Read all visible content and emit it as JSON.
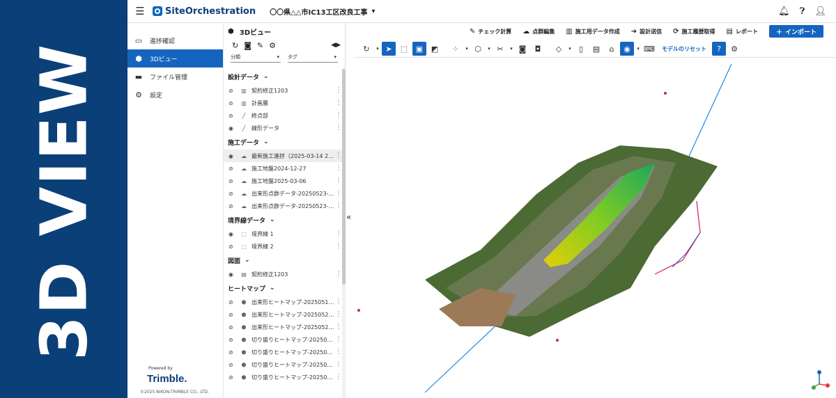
{
  "banner": {
    "text": "3D VIEW"
  },
  "app": {
    "name": "SiteOrchestration",
    "project": "〇〇県△△市IC13工区改良工事"
  },
  "nav": {
    "items": [
      {
        "label": "進捗確認",
        "icon": "monitor-icon"
      },
      {
        "label": "3Dビュー",
        "icon": "cube-icon",
        "active": true
      },
      {
        "label": "ファイル管理",
        "icon": "folder-icon"
      },
      {
        "label": "設定",
        "icon": "gear-icon"
      }
    ],
    "powered_by": "Powered by",
    "brand": "Trimble.",
    "copyright": "©2025 NIKON-TRIMBLE CO., LTD."
  },
  "panel": {
    "title": "3Dビュー",
    "filter1": "分類",
    "filter2": "タグ",
    "groups": [
      {
        "label": "設計データ",
        "layers": [
          {
            "name": "契約修正1203",
            "visible": false,
            "type": "map"
          },
          {
            "name": "計画層",
            "visible": false,
            "type": "map"
          },
          {
            "name": "終点部",
            "visible": false,
            "type": "line"
          },
          {
            "name": "線形データ",
            "visible": true,
            "type": "line"
          }
        ]
      },
      {
        "label": "施工データ",
        "layers": [
          {
            "name": "最新施工進捗（2025-03-14 2…",
            "visible": true,
            "type": "cloud",
            "selected": true
          },
          {
            "name": "施工地盤2024-12-27",
            "visible": false,
            "type": "cloud"
          },
          {
            "name": "施工地盤2025-03-06",
            "visible": false,
            "type": "cloud"
          },
          {
            "name": "出来形点群データ-20250523-…",
            "visible": false,
            "type": "cloud"
          },
          {
            "name": "出来形点群データ-20250523-…",
            "visible": false,
            "type": "cloud"
          }
        ]
      },
      {
        "label": "境界線データ",
        "layers": [
          {
            "name": "境界線 1",
            "visible": true,
            "type": "boundary"
          },
          {
            "name": "境界線 2",
            "visible": false,
            "type": "boundary"
          }
        ]
      },
      {
        "label": "図面",
        "layers": [
          {
            "name": "契約修正1203",
            "visible": true,
            "type": "drawing"
          }
        ]
      },
      {
        "label": "ヒートマップ",
        "layers": [
          {
            "name": "出来形ヒートマップ-2025051…",
            "visible": false,
            "type": "heatmap"
          },
          {
            "name": "出来形ヒートマップ-2025052…",
            "visible": false,
            "type": "heatmap"
          },
          {
            "name": "出来形ヒートマップ-2025052…",
            "visible": false,
            "type": "heatmap"
          },
          {
            "name": "切り盛りヒートマップ-20250…",
            "visible": false,
            "type": "heatmap"
          },
          {
            "name": "切り盛りヒートマップ-20250…",
            "visible": false,
            "type": "heatmap"
          },
          {
            "name": "切り盛りヒートマップ-20250…",
            "visible": false,
            "type": "heatmap"
          },
          {
            "name": "切り盛りヒートマップ-20250…",
            "visible": false,
            "type": "heatmap"
          }
        ]
      }
    ]
  },
  "actions": [
    {
      "label": "チェック計算",
      "icon": "ruler-icon"
    },
    {
      "label": "点群編集",
      "icon": "cloud-icon"
    },
    {
      "label": "施工用データ作成",
      "icon": "map-icon"
    },
    {
      "label": "設計送信",
      "icon": "arrow-right-icon"
    },
    {
      "label": "施工履歴取得",
      "icon": "sync-icon"
    },
    {
      "label": "レポート",
      "icon": "report-icon"
    }
  ],
  "import_label": "インポート",
  "toolbar": {
    "reset_label": "モデルのリセット"
  },
  "colors": {
    "brand_blue": "#1565c0",
    "banner_blue": "#0b3f78"
  }
}
